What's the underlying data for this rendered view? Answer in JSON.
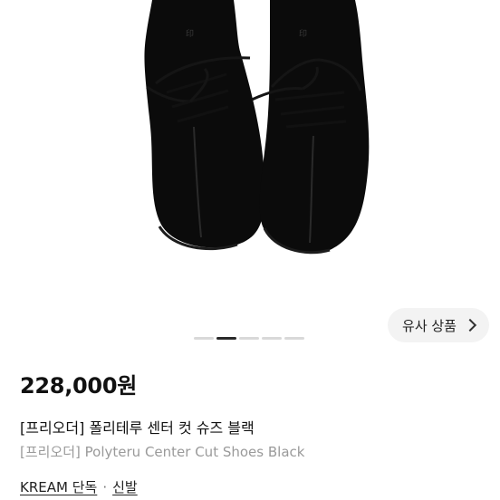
{
  "product": {
    "image_alt": "black suede lace-up shoes top view",
    "price": "228,000원",
    "title_ko": "[프리오더] 폴리테루 센터 컷 슈즈 블랙",
    "title_en": "[프리오더] Polyteru Center Cut Shoes Black",
    "brand_tag": "KREAM 단독",
    "separator": "·",
    "category": "신발"
  },
  "carousel": {
    "slide_count": 5,
    "active_index": 1
  },
  "similar": {
    "label": "유사 상품",
    "icon": "chevron-right-icon"
  },
  "colors": {
    "background": "#ffffff",
    "shoe": "#0a0a0a",
    "button_bg": "#f3f3f3",
    "secondary_text": "#9a9a9a"
  }
}
